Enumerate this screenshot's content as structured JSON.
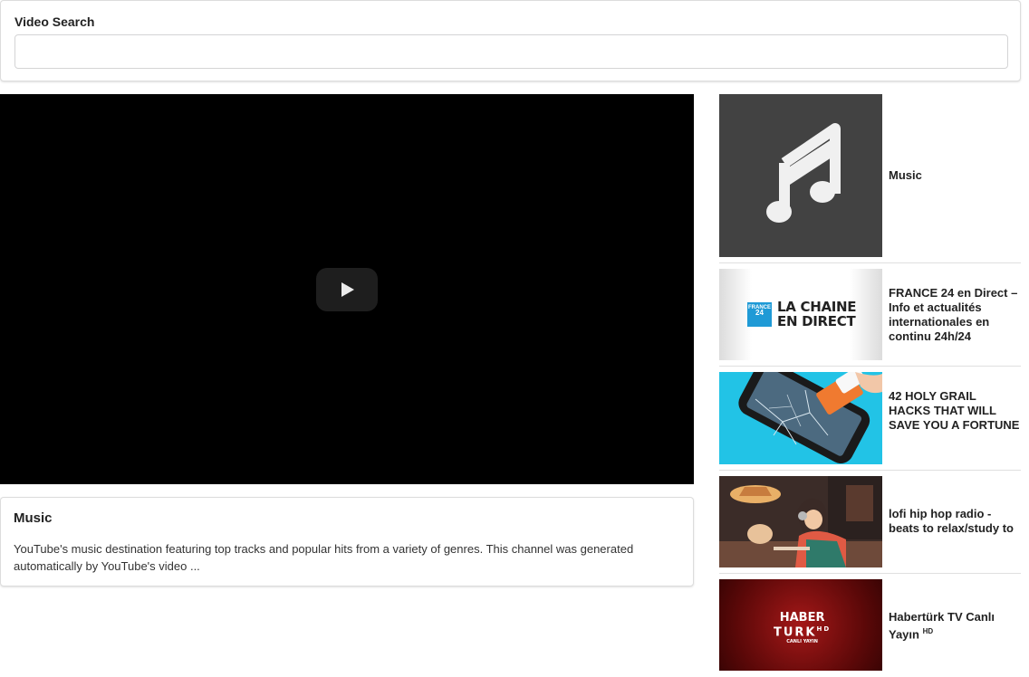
{
  "search": {
    "label": "Video Search",
    "value": "",
    "placeholder": ""
  },
  "player": {
    "play_icon": "play-icon"
  },
  "selected_video": {
    "title": "Music",
    "description": "YouTube's music destination featuring top tracks and popular hits from a variety of genres. This channel was generated automatically by YouTube's video ..."
  },
  "video_list": [
    {
      "title": "Music",
      "thumb_icon": "music-note-icon"
    },
    {
      "title": "FRANCE 24 en Direct – Info et actualités internationales en continu 24h/24",
      "thumb_text_1": "LA CHAINE",
      "thumb_text_2": "EN DIRECT",
      "thumb_logo_1": "FRANCE",
      "thumb_logo_2": "24"
    },
    {
      "title": "42 HOLY GRAIL HACKS THAT WILL SAVE YOU A FORTUNE"
    },
    {
      "title": "lofi hip hop radio - beats to relax/study to"
    },
    {
      "title": "Habertürk TV Canlı Yayın",
      "title_sup": "HD",
      "thumb_text_1": "HABER",
      "thumb_text_2": "TURK",
      "thumb_text_3": "CANLI YAYIN",
      "thumb_sup": "HD"
    }
  ],
  "colors": {
    "player_bg": "#000000",
    "music_thumb_bg": "#424242",
    "france24_blue": "#1f9ad6",
    "hacks_bg": "#22c3e6",
    "haberturk_red": "#7a0a0a"
  }
}
